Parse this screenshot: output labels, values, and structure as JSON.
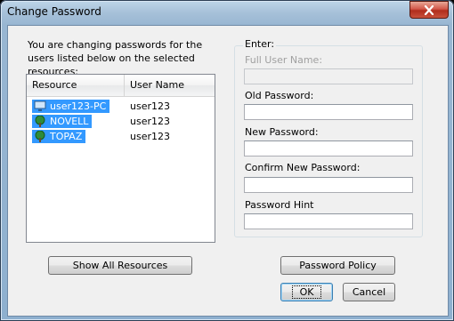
{
  "window": {
    "title": "Change Password"
  },
  "intro_text": "You are changing passwords for the users listed below on the selected resources:",
  "resource_list": {
    "columns": [
      "Resource",
      "User Name"
    ],
    "rows": [
      {
        "resource": "user123-PC",
        "user": "user123",
        "icon": "computer-icon"
      },
      {
        "resource": "NOVELL",
        "user": "user123",
        "icon": "tree-icon"
      },
      {
        "resource": "TOPAZ",
        "user": "user123",
        "icon": "tree-icon"
      }
    ]
  },
  "enter_group": {
    "label": "Enter:",
    "full_user_name": {
      "label": "Full User Name:",
      "value": ""
    },
    "old_password": {
      "label": "Old Password:",
      "value": ""
    },
    "new_password": {
      "label": "New Password:",
      "value": ""
    },
    "confirm_password": {
      "label": "Confirm New Password:",
      "value": ""
    },
    "password_hint": {
      "label": "Password Hint",
      "value": ""
    }
  },
  "buttons": {
    "show_all": "Show All Resources",
    "password_policy": "Password Policy",
    "ok": "OK",
    "cancel": "Cancel"
  },
  "colors": {
    "selection": "#3399ff",
    "close_button": "#c9503b"
  }
}
